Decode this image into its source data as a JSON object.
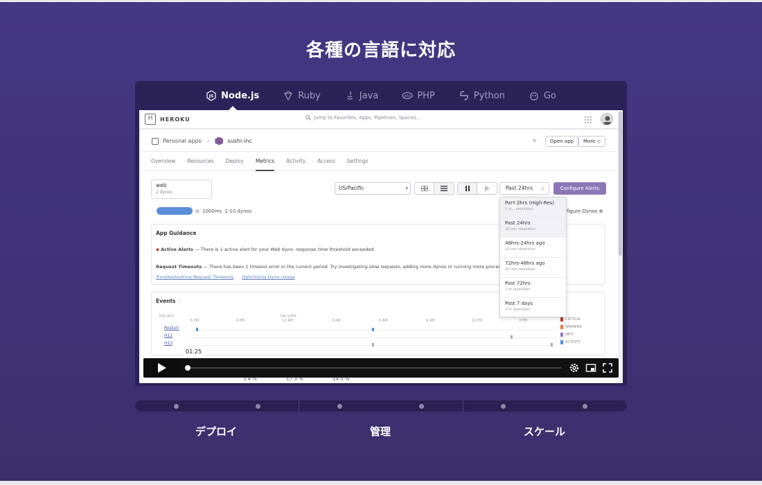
{
  "section": {
    "title": "各種の言語に対応"
  },
  "languages": [
    {
      "label": "Node.js",
      "icon": "nodejs-icon",
      "active": true
    },
    {
      "label": "Ruby",
      "icon": "ruby-icon",
      "active": false
    },
    {
      "label": "Java",
      "icon": "java-icon",
      "active": false
    },
    {
      "label": "PHP",
      "icon": "php-icon",
      "active": false
    },
    {
      "label": "Python",
      "icon": "python-icon",
      "active": false
    },
    {
      "label": "Go",
      "icon": "go-icon",
      "active": false
    }
  ],
  "heroku": {
    "brand": "HEROKU",
    "search_placeholder": "Jump to Favorites, Apps, Pipelines, Spaces...",
    "breadcrumb": {
      "root": "Personal apps",
      "app": "sushi-inc"
    },
    "open_app": "Open app",
    "more": "More ◇",
    "tabs": [
      "Overview",
      "Resources",
      "Deploy",
      "Metrics",
      "Activity",
      "Access",
      "Settings"
    ],
    "active_tab": "Metrics",
    "dyno": {
      "title": "web",
      "sub": "2 dynos"
    },
    "timezone": "US/Pacific",
    "range": "Past 24hrs",
    "configure_alerts": "Configure Alerts",
    "status": {
      "ms": "1000ms",
      "dynos": "1-10 dynos"
    },
    "configure_dynos": "figure Dynos",
    "guidance": {
      "title": "App Guidance",
      "alert_bold": "Active Alerts",
      "alert_text": " — There is 1 active alert for your Web dyno: response time threshold exceeded.",
      "timeout_bold": "Request Timeouts",
      "timeout_text": " — There has been 1 timeout error in the current period. Try investigating slow requests, adding more dynos or running more process",
      "link1": "Troubleshooting Request Timeouts",
      "link2": "Optimizing Dyno Usage"
    },
    "events": {
      "title": "Events",
      "day1": "THU 9TH",
      "day2": "FRI 10TH",
      "ticks": [
        "6 PM",
        "9 PM",
        "12 AM",
        "3 AM",
        "6 AM",
        "9 AM",
        "12 PM",
        "3 PM"
      ],
      "rows": [
        "Restart",
        "H12",
        "H13"
      ],
      "legend": [
        {
          "label": "CRITICAL",
          "color": "#c0392b"
        },
        {
          "label": "WARNING",
          "color": "#e07b39"
        },
        {
          "label": "INFO",
          "color": "#8e7cc3"
        },
        {
          "label": "ACTIVITY",
          "color": "#4a90e2"
        }
      ]
    },
    "range_options": [
      {
        "title": "Past 2hrs (High-Res)",
        "sub": "1 min resolution"
      },
      {
        "title": "Past 24hrs",
        "sub": "10 min resolution"
      },
      {
        "title": "48hrs-24hrs ago",
        "sub": "10 min resolution"
      },
      {
        "title": "72hrs-48hrs ago",
        "sub": "20 min resolution"
      },
      {
        "title": "Past 72hrs",
        "sub": "1 hr resolution"
      },
      {
        "title": "Past 7 days",
        "sub": "2 hr resolution"
      }
    ],
    "under_stats": [
      "3.4 %",
      "17.3 %",
      "14.5 %"
    ]
  },
  "player": {
    "time": "01:25",
    "progress": 0.0
  },
  "steps": [
    "デプロイ",
    "管理",
    "スケール"
  ]
}
